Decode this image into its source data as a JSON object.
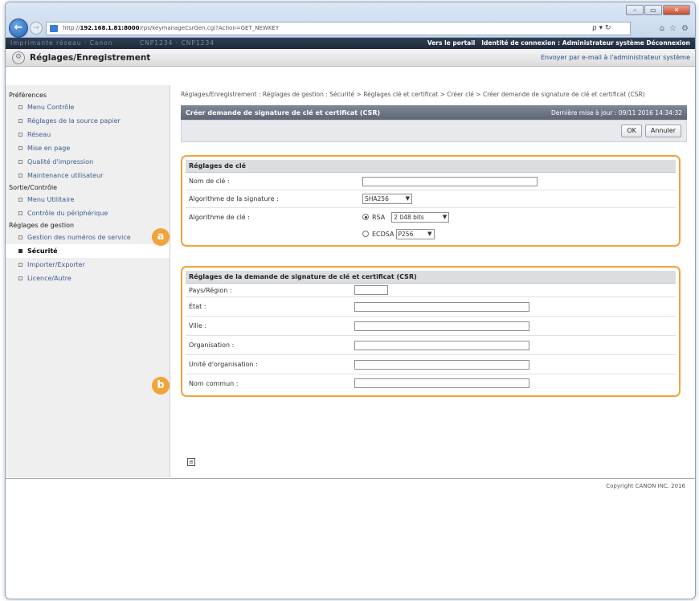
{
  "browser": {
    "url_prefix": "http://",
    "url_host": "192.168.1.81:8000",
    "url_path": "/rps/keymanageCsrGen.cgi?Action=GET_NEWKEY",
    "search_label": "ρ ▾ ↻"
  },
  "topbar": {
    "left_blurred": "Imprimante réseau · Canon",
    "middle_blurred": "CNP1234 · CNP1234",
    "portal": "Vers le portail",
    "login_label": "Identité de connexion :",
    "user": "Administrateur système",
    "logout": "Déconnexion"
  },
  "header": {
    "title": "Réglages/Enregistrement",
    "mail_link": "Envoyer par e-mail à l'administrateur système"
  },
  "sidebar": {
    "groups": [
      {
        "title": "Préférences",
        "items": [
          "Menu Contrôle",
          "Réglages de la source papier",
          "Réseau",
          "Mise en page",
          "Qualité d'impression",
          "Maintenance utilisateur"
        ]
      },
      {
        "title": "Sortie/Contrôle",
        "items": [
          "Menu Utilitaire",
          "Contrôle du périphérique"
        ]
      },
      {
        "title": "Réglages de gestion",
        "items": [
          "Gestion des numéros de service",
          "Sécurité",
          "Importer/Exporter",
          "Licence/Autre"
        ]
      }
    ]
  },
  "main": {
    "breadcrumb": "Réglages/Enregistrement : Réglages de gestion : Sécurité > Réglages clé et certificat > Créer clé > Créer demande de signature de clé et certificat (CSR)",
    "panel_title": "Créer demande de signature de clé et certificat (CSR)",
    "last_update": "Dernière mise à jour : 09/11 2016 14:34:32",
    "ok_label": "OK",
    "cancel_label": "Annuler",
    "key_settings": {
      "badge": "a",
      "title": "Réglages de clé",
      "key_name_label": "Nom de clé :",
      "signature_algo_label": "Algorithme de la signature :",
      "signature_algo_value": "SHA256",
      "key_algo_label": "Algorithme de clé :",
      "rsa_label": "RSA",
      "rsa_bits": "2 048 bits",
      "ecdsa_label": "ECDSA",
      "ecdsa_curve": "P256"
    },
    "csr_settings": {
      "badge": "b",
      "title": "Réglages de la demande de signature de clé et certificat (CSR)",
      "fields": [
        "Pays/Région :",
        "État :",
        "Ville :",
        "Organisation :",
        "Unité d'organisation :",
        "Nom commun :"
      ]
    }
  },
  "footer": {
    "copyright": "Copyright CANON INC. 2016"
  }
}
